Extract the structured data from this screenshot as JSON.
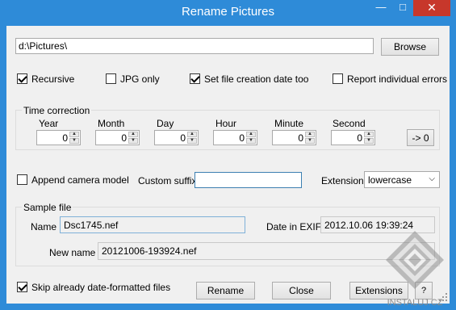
{
  "window": {
    "title": "Rename Pictures"
  },
  "path": {
    "value": "d:\\Pictures\\",
    "browse_label": "Browse"
  },
  "options": {
    "recursive": "Recursive",
    "recursive_checked": true,
    "jpg_only": "JPG only",
    "jpg_only_checked": false,
    "set_creation_date": "Set file creation date too",
    "set_creation_date_checked": true,
    "report_errors": "Report individual errors",
    "report_errors_checked": false
  },
  "time_correction": {
    "label": "Time correction",
    "fields": [
      {
        "label": "Year",
        "value": "0"
      },
      {
        "label": "Month",
        "value": "0"
      },
      {
        "label": "Day",
        "value": "0"
      },
      {
        "label": "Hour",
        "value": "0"
      },
      {
        "label": "Minute",
        "value": "0"
      },
      {
        "label": "Second",
        "value": "0"
      }
    ],
    "reset_label": "-> 0"
  },
  "naming": {
    "append_camera_model": "Append camera model",
    "append_camera_model_checked": false,
    "custom_suffix_label": "Custom suffix",
    "custom_suffix_value": "",
    "extension_label": "Extension",
    "extension_value": "lowercase"
  },
  "sample": {
    "label": "Sample file",
    "name_label": "Name",
    "name_value": "Dsc1745.nef",
    "date_label": "Date in EXIF",
    "date_value": "2012.10.06 19:39:24",
    "new_name_label": "New name",
    "new_name_value": "20121006-193924.nef"
  },
  "bottom": {
    "skip_formatted": "Skip already date-formatted files",
    "skip_formatted_checked": true,
    "rename_label": "Rename",
    "close_label": "Close",
    "extensions_label": "Extensions",
    "help_label": "?"
  },
  "watermark": {
    "text": "INSTALUJ.CZ"
  },
  "colors": {
    "title_bar": "#2e8bd8",
    "close_button": "#c7372b",
    "dialog_bg": "#f0f0f0"
  }
}
